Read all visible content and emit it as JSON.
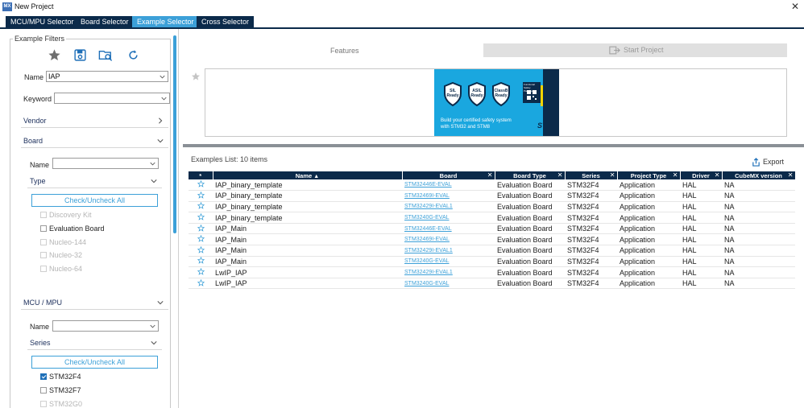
{
  "window": {
    "app_icon": "MX",
    "title": "New Project",
    "close": "✕"
  },
  "tabs": [
    {
      "label": "MCU/MPU Selector",
      "active": false
    },
    {
      "label": "Board Selector",
      "active": false
    },
    {
      "label": "Example Selector",
      "active": true
    },
    {
      "label": "Cross Selector",
      "active": false
    }
  ],
  "filters": {
    "legend": "Example Filters",
    "icons": [
      "star-icon",
      "save-icon",
      "load-icon",
      "reset-icon"
    ],
    "name_label": "Name",
    "name_value": "IAP",
    "keyword_label": "Keyword",
    "keyword_value": "",
    "vendor_label": "Vendor",
    "board_label": "Board",
    "board_name_label": "Name",
    "type_label": "Type",
    "check_uncheck_all": "Check/Uncheck All",
    "types": [
      {
        "label": "Discovery Kit",
        "enabled": false,
        "checked": false
      },
      {
        "label": "Evaluation Board",
        "enabled": true,
        "checked": false
      },
      {
        "label": "Nucleo-144",
        "enabled": false,
        "checked": false
      },
      {
        "label": "Nucleo-32",
        "enabled": false,
        "checked": false
      },
      {
        "label": "Nucleo-64",
        "enabled": false,
        "checked": false
      }
    ],
    "mcu_label": "MCU / MPU",
    "mcu_name_label": "Name",
    "series_label": "Series",
    "series_check_all": "Check/Uncheck All",
    "series": [
      {
        "label": "STM32F4",
        "enabled": true,
        "checked": true
      },
      {
        "label": "STM32F7",
        "enabled": true,
        "checked": false
      },
      {
        "label": "STM32G0",
        "enabled": false,
        "checked": false
      }
    ]
  },
  "main": {
    "features_label": "Features",
    "start_project_label": "Start Project",
    "banner": {
      "badges": [
        "SIL Ready",
        "ASIL Ready",
        "ClassB Ready"
      ],
      "qr_caption": "Functional Safety Packages",
      "line1": "Build your certified safety system",
      "line2": "with STM32 and STM8",
      "logo": "ST"
    },
    "examples_label": "Examples List: 10 items",
    "export_label": "Export",
    "columns": [
      "*",
      "Name",
      "Board",
      "Board Type",
      "Series",
      "Project Type",
      "Driver",
      "CubeMX version"
    ],
    "rows": [
      {
        "name": "IAP_binary_template",
        "board": "STM32446E-EVAL",
        "board_type": "Evaluation Board",
        "series": "STM32F4",
        "project_type": "Application",
        "driver": "HAL",
        "cubemx": "NA"
      },
      {
        "name": "IAP_binary_template",
        "board": "STM32469I-EVAL",
        "board_type": "Evaluation Board",
        "series": "STM32F4",
        "project_type": "Application",
        "driver": "HAL",
        "cubemx": "NA"
      },
      {
        "name": "IAP_binary_template",
        "board": "STM32429I-EVAL1",
        "board_type": "Evaluation Board",
        "series": "STM32F4",
        "project_type": "Application",
        "driver": "HAL",
        "cubemx": "NA"
      },
      {
        "name": "IAP_binary_template",
        "board": "STM3240G-EVAL",
        "board_type": "Evaluation Board",
        "series": "STM32F4",
        "project_type": "Application",
        "driver": "HAL",
        "cubemx": "NA"
      },
      {
        "name": "IAP_Main",
        "board": "STM32446E-EVAL",
        "board_type": "Evaluation Board",
        "series": "STM32F4",
        "project_type": "Application",
        "driver": "HAL",
        "cubemx": "NA"
      },
      {
        "name": "IAP_Main",
        "board": "STM32469I-EVAL",
        "board_type": "Evaluation Board",
        "series": "STM32F4",
        "project_type": "Application",
        "driver": "HAL",
        "cubemx": "NA"
      },
      {
        "name": "IAP_Main",
        "board": "STM32429I-EVAL1",
        "board_type": "Evaluation Board",
        "series": "STM32F4",
        "project_type": "Application",
        "driver": "HAL",
        "cubemx": "NA"
      },
      {
        "name": "IAP_Main",
        "board": "STM3240G-EVAL",
        "board_type": "Evaluation Board",
        "series": "STM32F4",
        "project_type": "Application",
        "driver": "HAL",
        "cubemx": "NA"
      },
      {
        "name": "LwIP_IAP",
        "board": "STM32429I-EVAL1",
        "board_type": "Evaluation Board",
        "series": "STM32F4",
        "project_type": "Application",
        "driver": "HAL",
        "cubemx": "NA"
      },
      {
        "name": "LwIP_IAP",
        "board": "STM3240G-EVAL",
        "board_type": "Evaluation Board",
        "series": "STM32F4",
        "project_type": "Application",
        "driver": "HAL",
        "cubemx": "NA"
      }
    ]
  },
  "colors": {
    "navy": "#0b2a4a",
    "accent": "#3ca0d8",
    "link": "#3ca0d8"
  }
}
